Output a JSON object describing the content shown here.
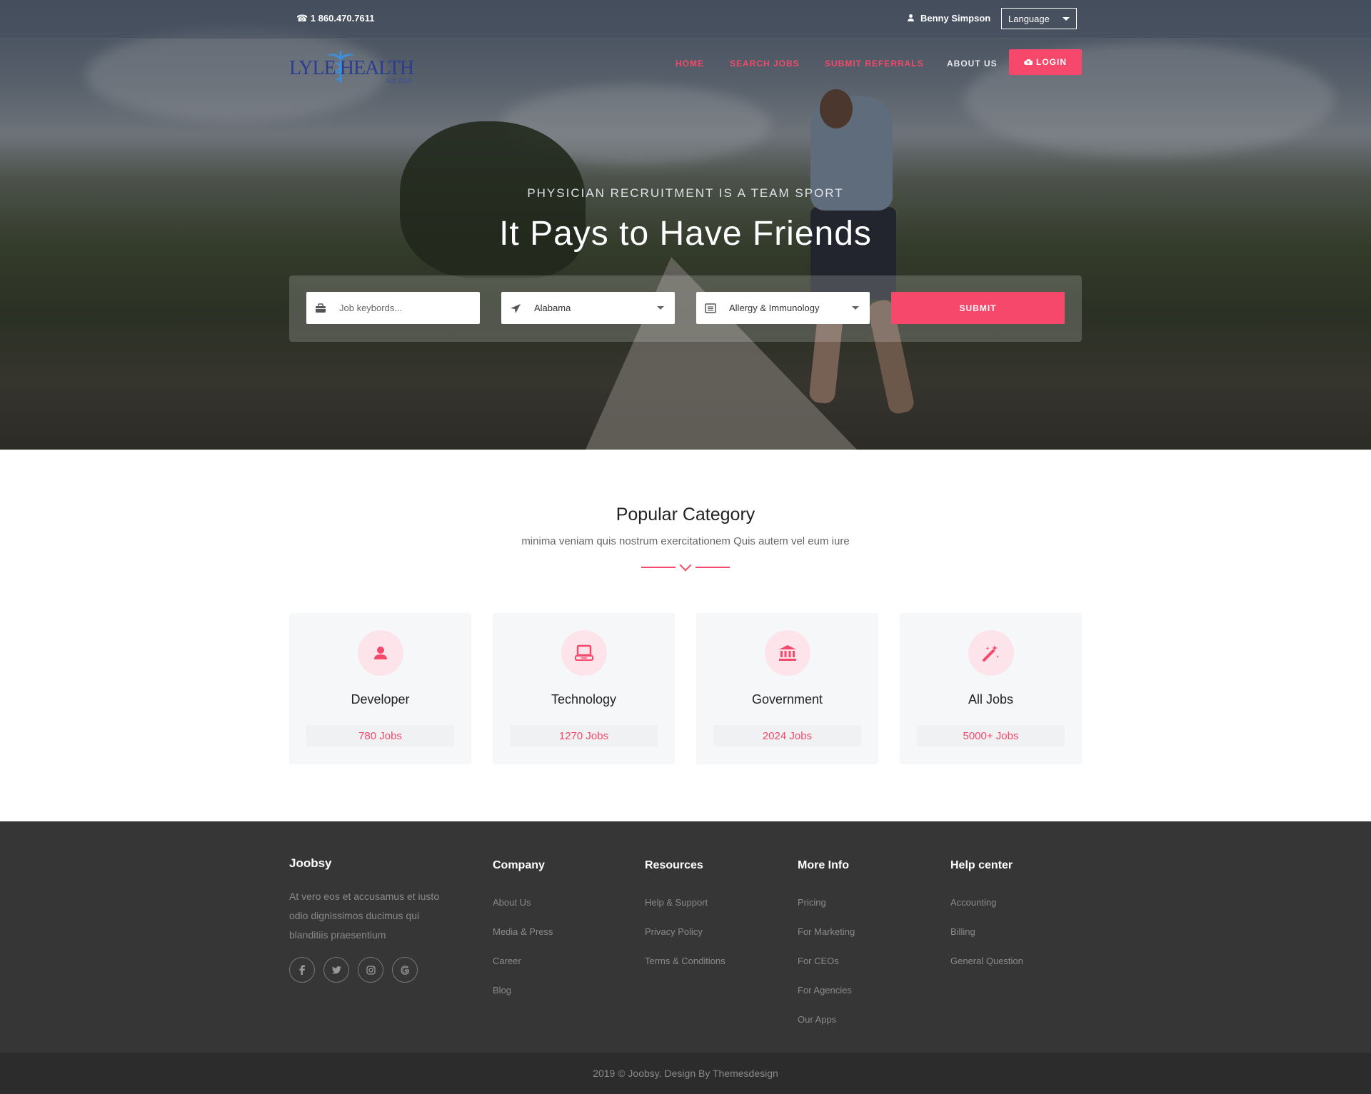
{
  "topbar": {
    "phone": "☎ 1 860.470.7611",
    "user_name": "Benny Simpson",
    "language_label": "Language"
  },
  "brand": {
    "logo_text": "LYLE HEALTH",
    "logo_sub": "Est 2016"
  },
  "nav": {
    "items": [
      "HOME",
      "SEARCH JOBS",
      "SUBMIT REFERRALS",
      "ABOUT US"
    ],
    "login_label": "LOGIN"
  },
  "hero": {
    "tagline": "PHYSICIAN RECRUITMENT IS A TEAM SPORT",
    "headline": "It Pays to Have Friends"
  },
  "search": {
    "keyword_placeholder": "Job keybords...",
    "state_value": "Alabama",
    "specialty_value": "Allergy & Immunology",
    "submit_label": "SUBMIT"
  },
  "popular": {
    "title": "Popular Category",
    "subtitle": "minima veniam quis nostrum exercitationem Quis autem vel eum iure",
    "categories": [
      {
        "name": "Developer",
        "count": "780 Jobs",
        "icon": "user-icon"
      },
      {
        "name": "Technology",
        "count": "1270 Jobs",
        "icon": "laptop-icon"
      },
      {
        "name": "Government",
        "count": "2024 Jobs",
        "icon": "bank-icon"
      },
      {
        "name": "All Jobs",
        "count": "5000+ Jobs",
        "icon": "magic-wand-icon"
      }
    ]
  },
  "footer": {
    "brand": "Joobsy",
    "description": "At vero eos et accusamus et iusto odio dignissimos ducimus qui blanditiis praesentium",
    "social": [
      "facebook-icon",
      "twitter-icon",
      "instagram-icon",
      "google-icon"
    ],
    "columns": [
      {
        "title": "Company",
        "links": [
          "About Us",
          "Media & Press",
          "Career",
          "Blog"
        ]
      },
      {
        "title": "Resources",
        "links": [
          "Help & Support",
          "Privacy Policy",
          "Terms & Conditions"
        ]
      },
      {
        "title": "More Info",
        "links": [
          "Pricing",
          "For Marketing",
          "For CEOs",
          "For Agencies",
          "Our Apps"
        ]
      },
      {
        "title": "Help center",
        "links": [
          "Accounting",
          "Billing",
          "General Question"
        ]
      }
    ],
    "copyright": "2019 © Joobsy. Design By Themesdesign"
  },
  "colors": {
    "accent": "#f5486a",
    "footer_bg": "#363636",
    "footer_bottom_bg": "#2c2c2c"
  }
}
